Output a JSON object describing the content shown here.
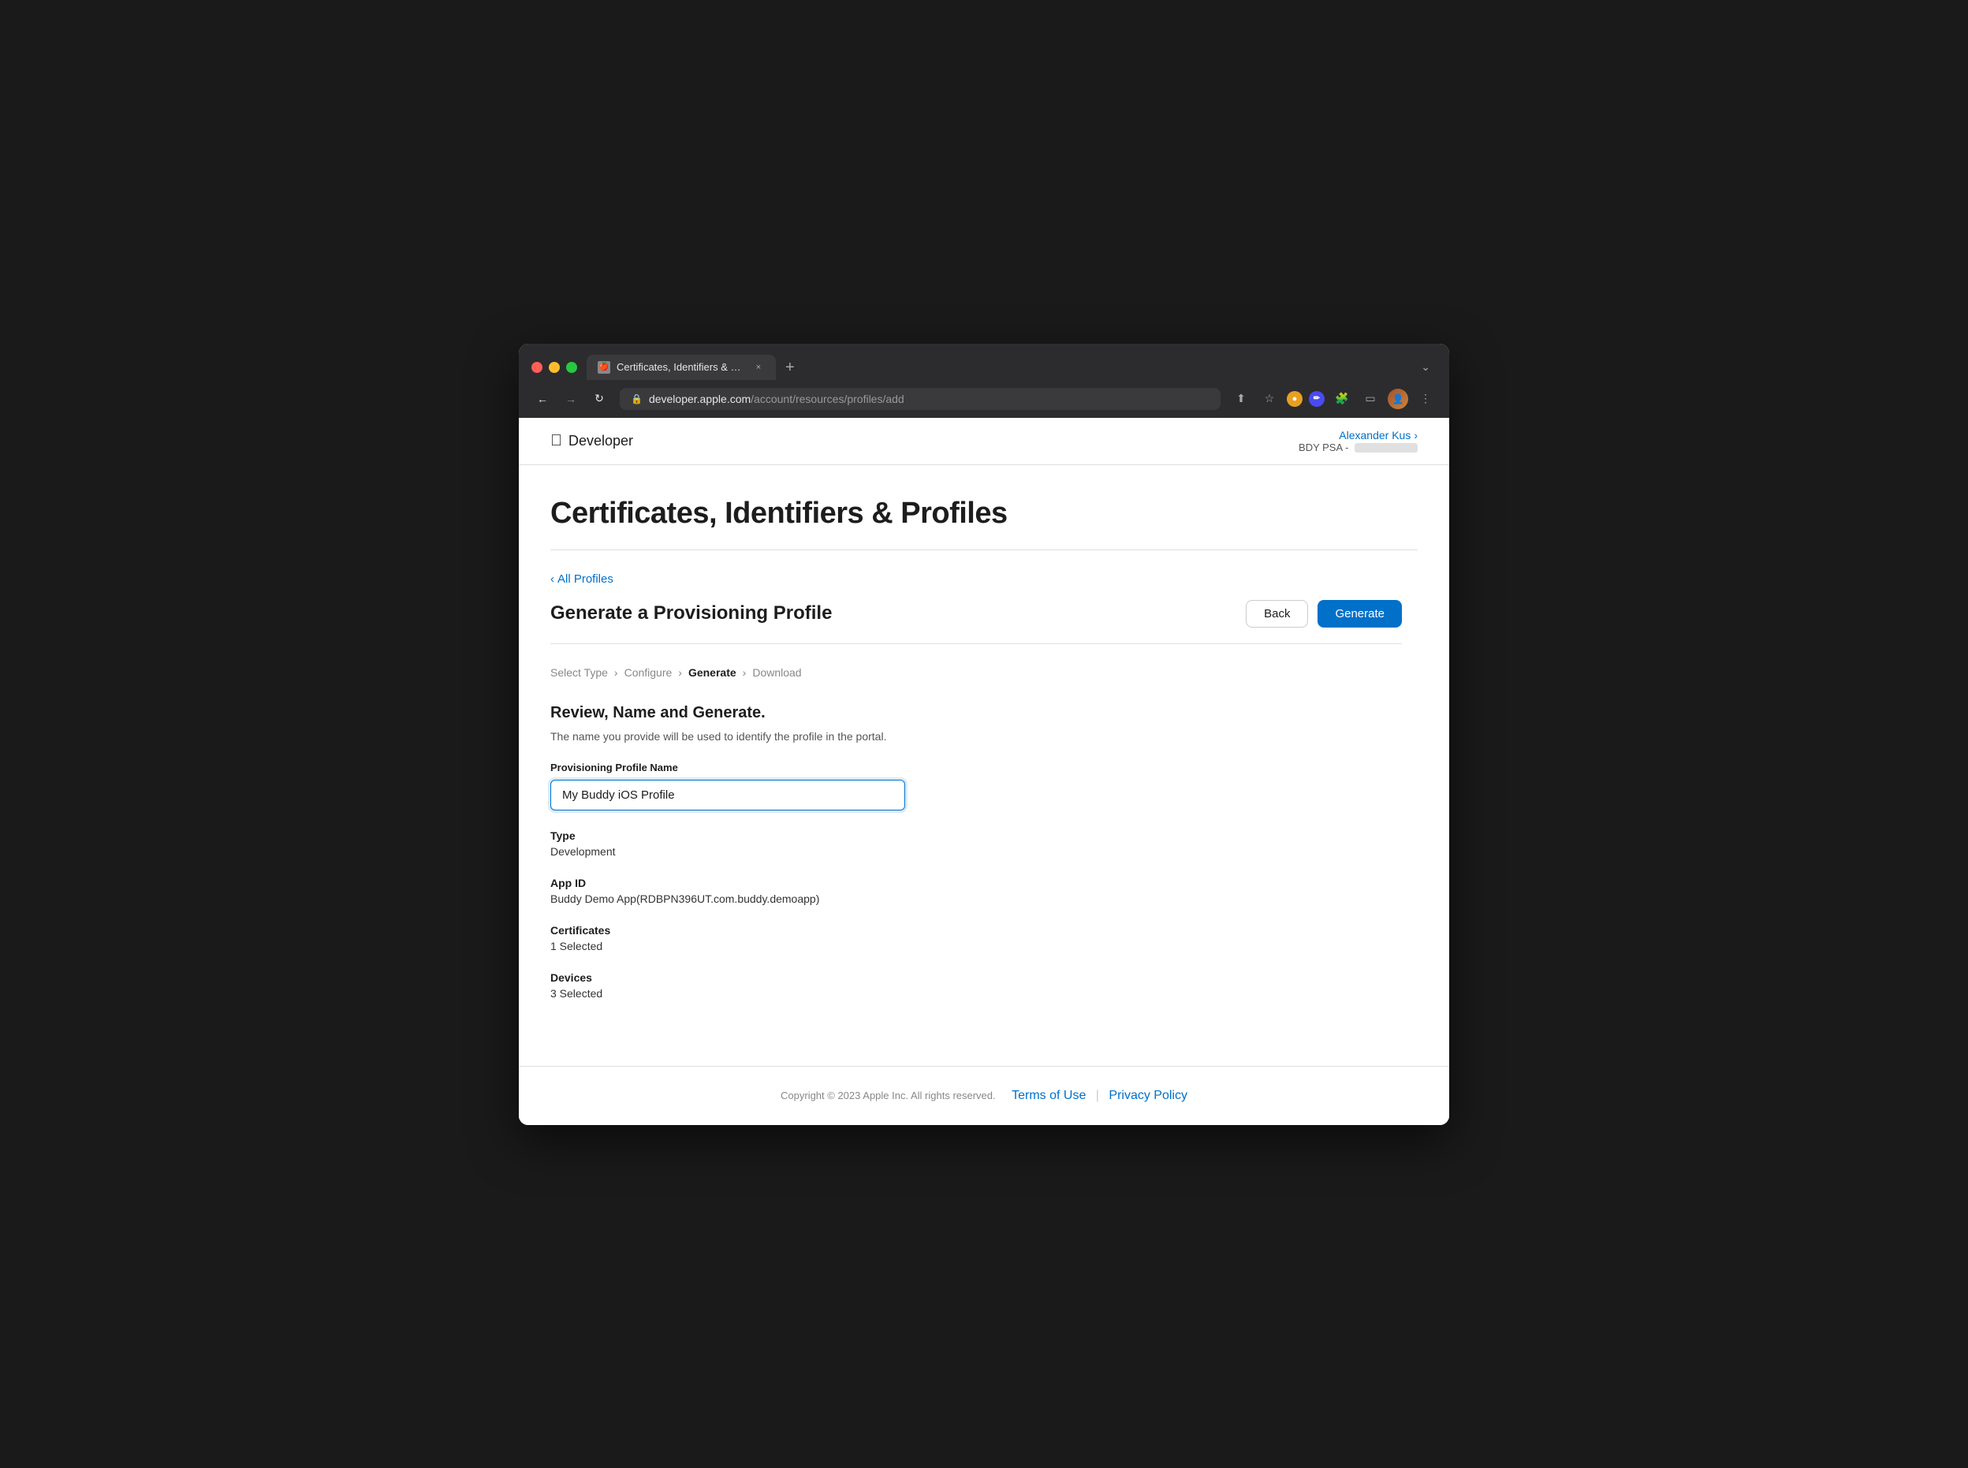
{
  "browser": {
    "tab": {
      "favicon": "🍎",
      "title": "Certificates, Identifiers & Profi",
      "close": "×"
    },
    "new_tab": "+",
    "tab_dropdown": "⌄",
    "url": {
      "full": "developer.apple.com/account/resources/profiles/add",
      "domain": "developer.apple.com",
      "path": "/account/resources/profiles/add"
    },
    "nav": {
      "back": "←",
      "forward": "→",
      "refresh": "↻"
    }
  },
  "header": {
    "apple_logo": "",
    "developer_label": "Developer",
    "user_name": "Alexander Kus",
    "user_name_arrow": "›",
    "user_team": "BDY PSA -"
  },
  "page": {
    "title": "Certificates, Identifiers & Profiles"
  },
  "breadcrumb": {
    "arrow": "‹",
    "label": "All Profiles"
  },
  "section": {
    "title": "Generate a Provisioning Profile",
    "back_btn": "Back",
    "generate_btn": "Generate"
  },
  "steps": [
    {
      "label": "Select Type",
      "active": false
    },
    {
      "label": "Configure",
      "active": false
    },
    {
      "label": "Generate",
      "active": true
    },
    {
      "label": "Download",
      "active": false
    }
  ],
  "form": {
    "section_title": "Review, Name and Generate.",
    "description": "The name you provide will be used to identify the profile in the portal.",
    "name_label": "Provisioning Profile Name",
    "name_value": "My Buddy iOS Profile",
    "type_label": "Type",
    "type_value": "Development",
    "app_id_label": "App ID",
    "app_id_value": "Buddy Demo App(RDBPN396UT.com.buddy.demoapp)",
    "certificates_label": "Certificates",
    "certificates_value": "1 Selected",
    "devices_label": "Devices",
    "devices_value": "3 Selected"
  },
  "footer": {
    "copyright": "Copyright © 2023 Apple Inc. All rights reserved.",
    "terms_label": "Terms of Use",
    "separator": "|",
    "privacy_label": "Privacy Policy"
  }
}
